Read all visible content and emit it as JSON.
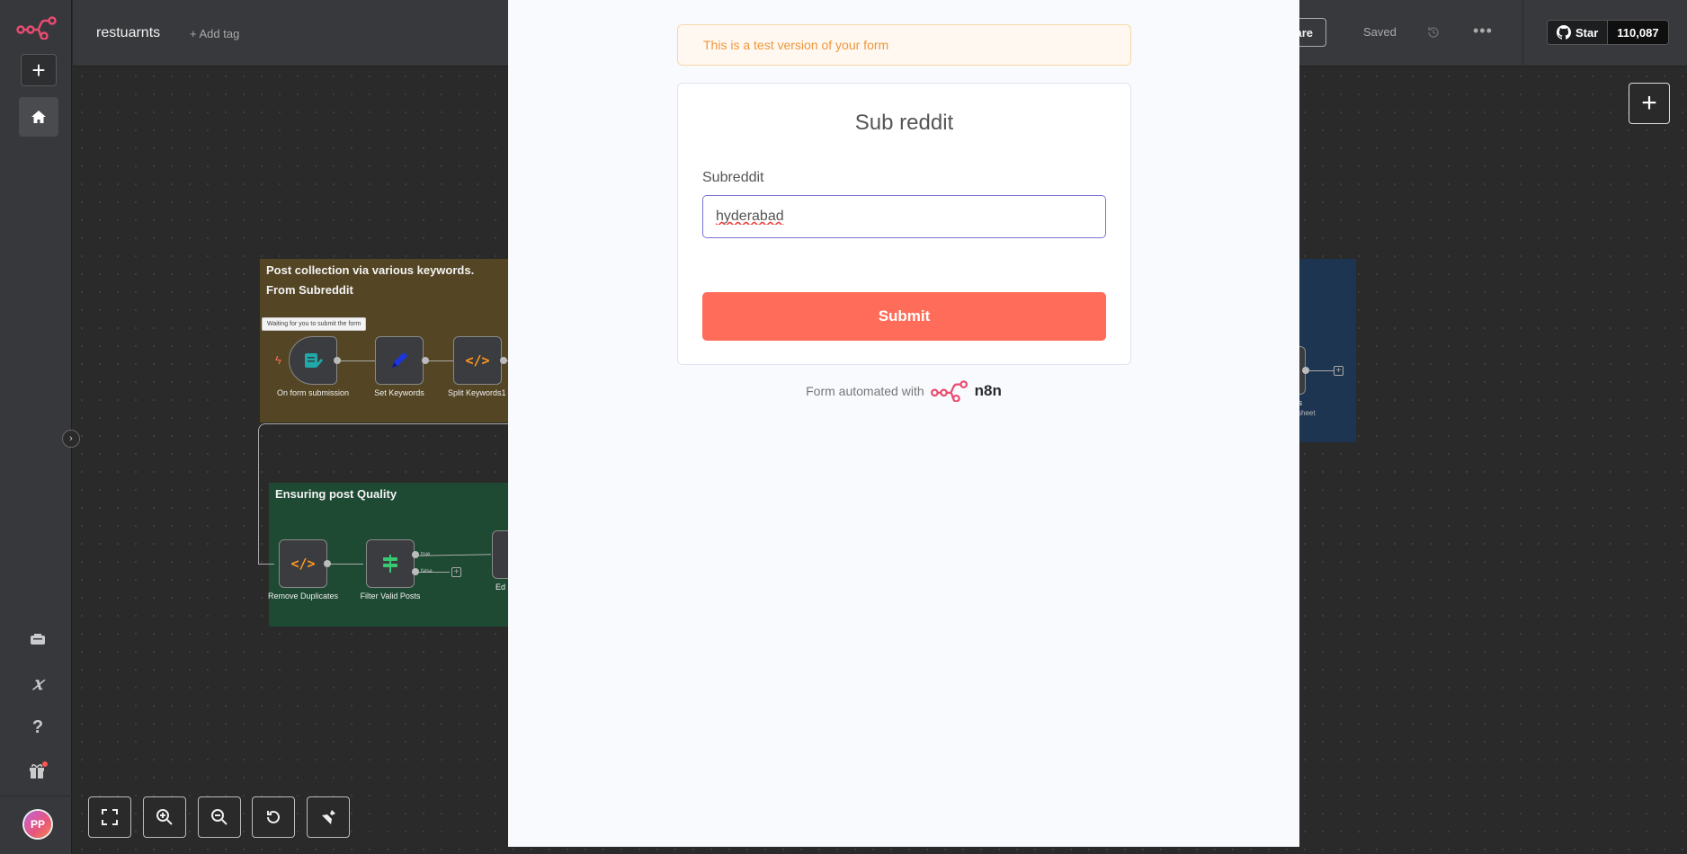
{
  "sidebar": {
    "logo_icon": "n8n-logo-icon",
    "add_icon": "plus-icon",
    "home_icon": "home-icon",
    "bottom_icons": [
      "templates-icon",
      "variables-icon",
      "help-icon",
      "whats-new-gift-icon"
    ],
    "avatar_initials": "PP"
  },
  "topbar": {
    "workflow_name": "restuarnts",
    "add_tag": "+ Add tag",
    "share_label": "are",
    "saved_label": "Saved",
    "github": {
      "star_label": "Star",
      "star_count": "110,087"
    }
  },
  "canvas": {
    "sticky_notes": [
      {
        "title_line1": "Post collection via various keywords.",
        "title_line2": "From Subreddit"
      },
      {
        "title": "Ensuring post Quality"
      }
    ],
    "tooltip": "Waiting for you to submit the form",
    "nodes": [
      {
        "label": "On form submission",
        "icon": "form-icon"
      },
      {
        "label": "Set Keywords",
        "icon": "pen-icon"
      },
      {
        "label": "Split Keywords1",
        "icon": "code-icon"
      },
      {
        "label": "Remove Duplicates",
        "icon": "code-icon"
      },
      {
        "label": "Filter Valid Posts",
        "icon": "filter-icon"
      },
      {
        "label": "Ed",
        "icon": "edit-icon"
      },
      {
        "label": "ets",
        "sublabel": "sheet",
        "icon": "sheets-icon"
      }
    ],
    "branch_labels": {
      "true": "true",
      "false": "false"
    }
  },
  "zoom_controls": [
    "fit-view-icon",
    "zoom-in-icon",
    "zoom-out-icon",
    "reset-zoom-icon",
    "tidy-up-icon"
  ],
  "form": {
    "test_banner": "This is a test version of your form",
    "title": "Sub reddit",
    "field_label": "Subreddit",
    "field_value": "hyderabad",
    "submit_label": "Submit",
    "footer_text": "Form automated with",
    "footer_brand": "n8n"
  },
  "colors": {
    "accent": "#ff6d5a",
    "input_border": "#7a73d6",
    "banner_text": "#f0963b",
    "canvas_bg": "#2a2a2b"
  }
}
